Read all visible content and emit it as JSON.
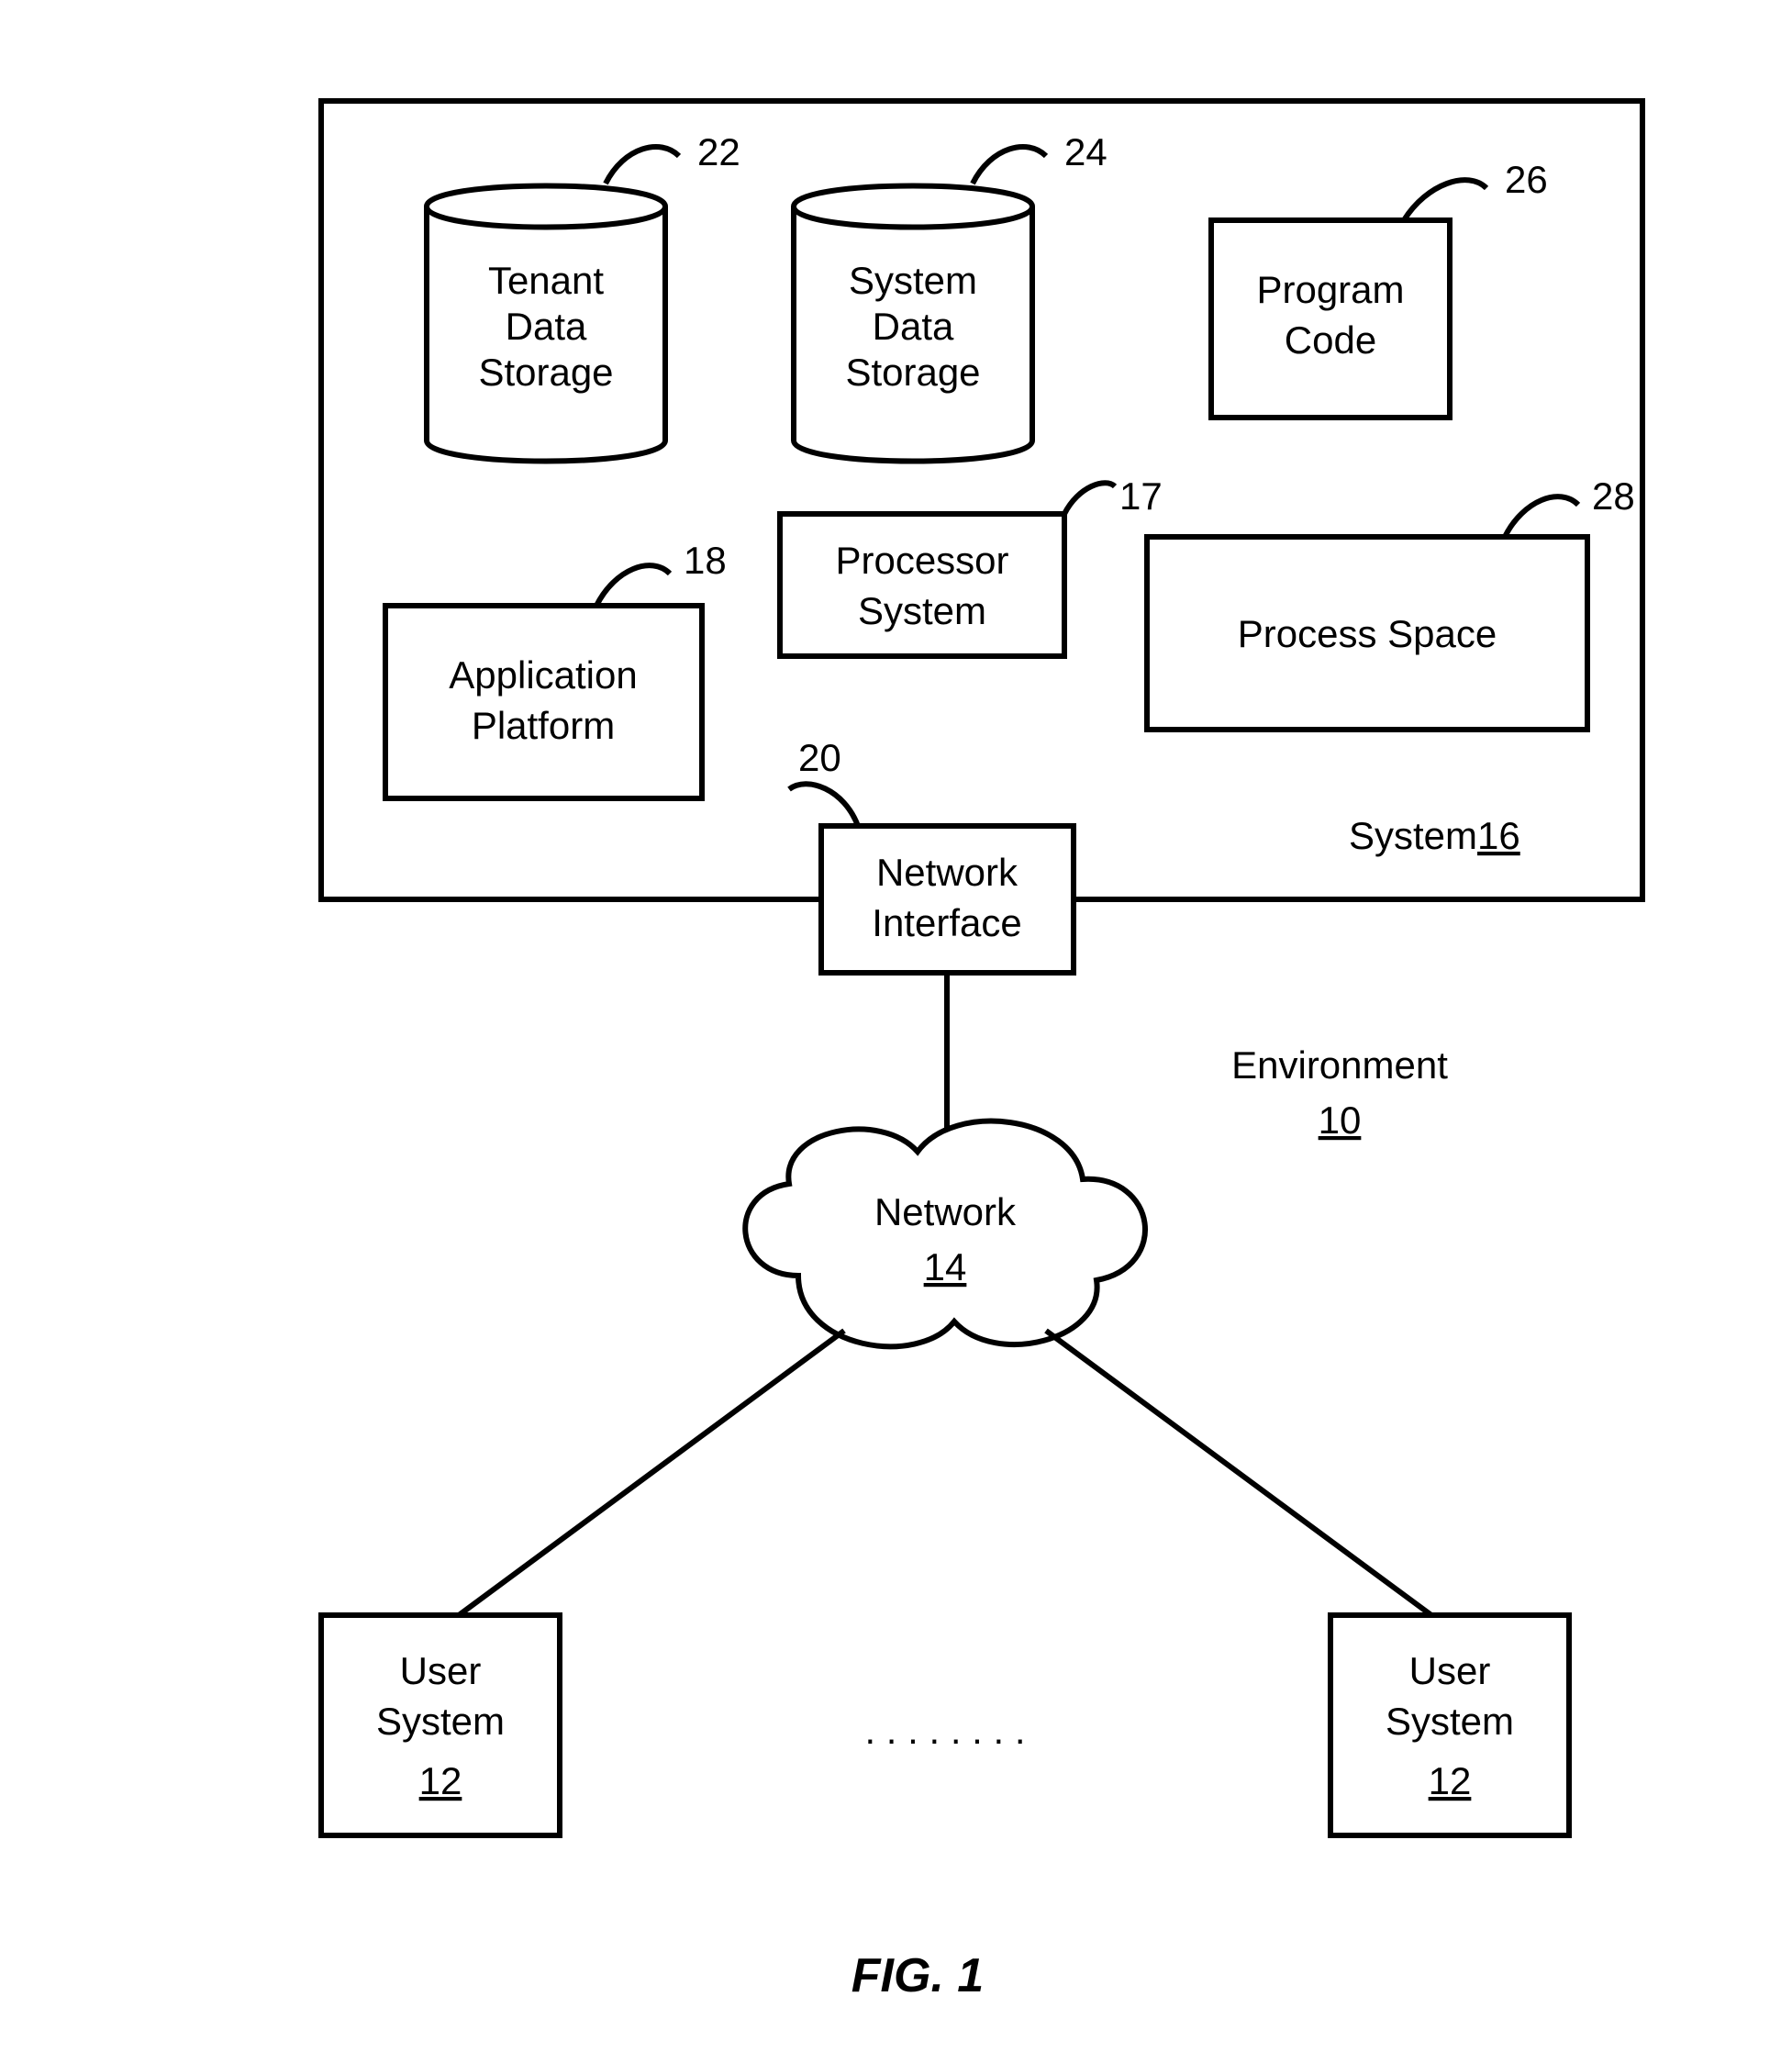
{
  "figure_label": "FIG. 1",
  "environment": {
    "label": "Environment",
    "num": "10"
  },
  "system": {
    "label": "System",
    "num": "16"
  },
  "network": {
    "label": "Network",
    "num": "14"
  },
  "tenant_ds": {
    "l1": "Tenant",
    "l2": "Data",
    "l3": "Storage",
    "num": "22"
  },
  "system_ds": {
    "l1": "System",
    "l2": "Data",
    "l3": "Storage",
    "num": "24"
  },
  "program_code": {
    "l1": "Program",
    "l2": "Code",
    "num": "26"
  },
  "app_platform": {
    "l1": "Application",
    "l2": "Platform",
    "num": "18"
  },
  "processor": {
    "l1": "Processor",
    "l2": "System",
    "num": "17"
  },
  "process_space": {
    "label": "Process Space",
    "num": "28"
  },
  "net_if": {
    "l1": "Network",
    "l2": "Interface",
    "num": "20"
  },
  "user_left": {
    "l1": "User",
    "l2": "System",
    "num": "12"
  },
  "user_right": {
    "l1": "User",
    "l2": "System",
    "num": "12"
  },
  "dots": ". . . . . . . ."
}
